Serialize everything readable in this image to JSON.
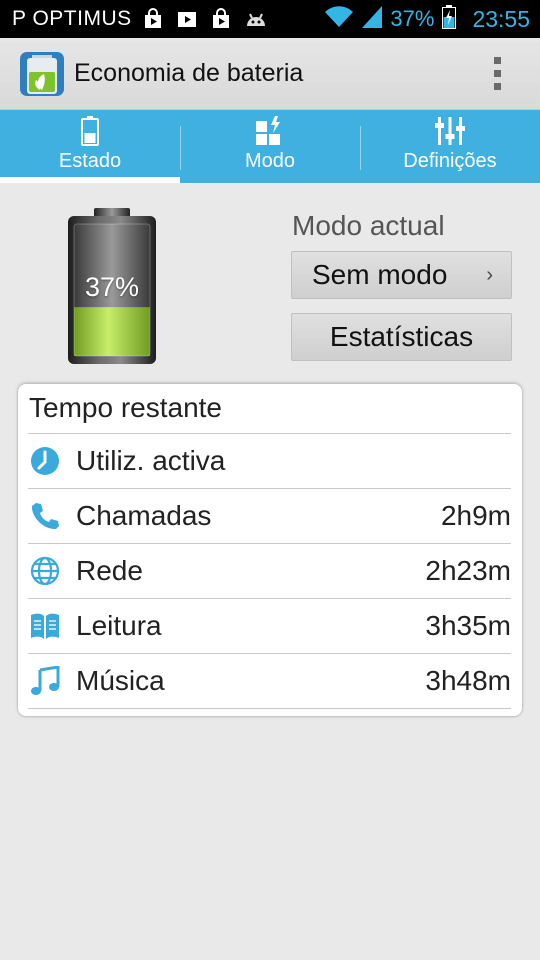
{
  "status_bar": {
    "carrier": "P OPTIMUS",
    "battery_percent": "37%",
    "time": "23:55",
    "notification_icons": [
      "bag-icon",
      "play-store-icon",
      "bag-icon",
      "android-icon"
    ]
  },
  "action_bar": {
    "title": "Economia de bateria"
  },
  "tabs": [
    {
      "label": "Estado",
      "icon": "battery-icon",
      "active": true
    },
    {
      "label": "Modo",
      "icon": "mode-grid-icon",
      "active": false
    },
    {
      "label": "Definições",
      "icon": "sliders-icon",
      "active": false
    }
  ],
  "battery": {
    "percent_label": "37%",
    "level": 0.37
  },
  "mode": {
    "heading": "Modo actual",
    "current": "Sem modo",
    "chevron": "›",
    "stats_button": "Estatísticas"
  },
  "remaining": {
    "title": "Tempo restante",
    "rows": [
      {
        "icon": "clock-icon",
        "label": "Utiliz. activa",
        "value": ""
      },
      {
        "icon": "phone-icon",
        "label": "Chamadas",
        "value": "2h9m"
      },
      {
        "icon": "globe-icon",
        "label": "Rede",
        "value": "2h23m"
      },
      {
        "icon": "book-icon",
        "label": "Leitura",
        "value": "3h35m"
      },
      {
        "icon": "music-note-icon",
        "label": "Música",
        "value": "3h48m"
      }
    ]
  },
  "colors": {
    "accent": "#33b5e5",
    "tab_bar": "#3fb0e0",
    "battery_green": "#9ccc3a"
  }
}
